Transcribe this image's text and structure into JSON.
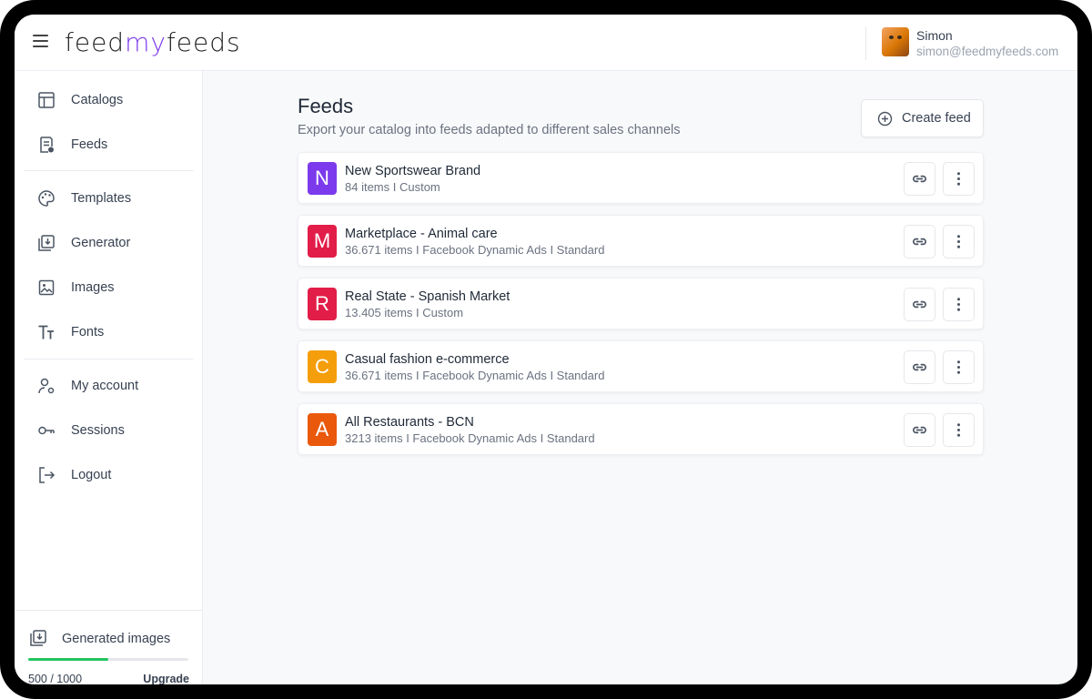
{
  "app": {
    "logo_part1": "feed",
    "logo_part2": "my",
    "logo_part3": "feeds"
  },
  "user": {
    "name": "Simon",
    "email": "simon@feedmyfeeds.com"
  },
  "sidebar": {
    "items": [
      {
        "label": "Catalogs",
        "icon": "catalog-icon"
      },
      {
        "label": "Feeds",
        "icon": "feeds-icon"
      },
      {
        "label": "Templates",
        "icon": "palette-icon"
      },
      {
        "label": "Generator",
        "icon": "generator-icon"
      },
      {
        "label": "Images",
        "icon": "image-icon"
      },
      {
        "label": "Fonts",
        "icon": "fonts-icon"
      },
      {
        "label": "My account",
        "icon": "account-icon"
      },
      {
        "label": "Sessions",
        "icon": "key-icon"
      },
      {
        "label": "Logout",
        "icon": "logout-icon"
      }
    ],
    "generated": {
      "label": "Generated images",
      "count": "500 / 1000",
      "progress": 0.5,
      "upgrade_label": "Upgrade"
    }
  },
  "main": {
    "title": "Feeds",
    "subtitle": "Export your catalog into feeds adapted to different sales channels",
    "create_label": "Create feed",
    "feeds": [
      {
        "letter": "N",
        "name": "New Sportswear Brand",
        "meta": "84 items I Custom",
        "color": "#7c3aed"
      },
      {
        "letter": "M",
        "name": "Marketplace - Animal care",
        "meta": "36.671 items I Facebook Dynamic Ads I Standard",
        "color": "#e11d48"
      },
      {
        "letter": "R",
        "name": "Real State - Spanish Market",
        "meta": "13.405 items I Custom",
        "color": "#e11d48"
      },
      {
        "letter": "C",
        "name": "Casual fashion e-commerce",
        "meta": "36.671 items I Facebook Dynamic Ads I Standard",
        "color": "#f59e0b"
      },
      {
        "letter": "A",
        "name": "All Restaurants - BCN",
        "meta": "3213 items I Facebook Dynamic Ads I Standard",
        "color": "#ea580c"
      }
    ]
  },
  "colors": {
    "brand": "#7c3aed",
    "progress": "#22c55e"
  }
}
